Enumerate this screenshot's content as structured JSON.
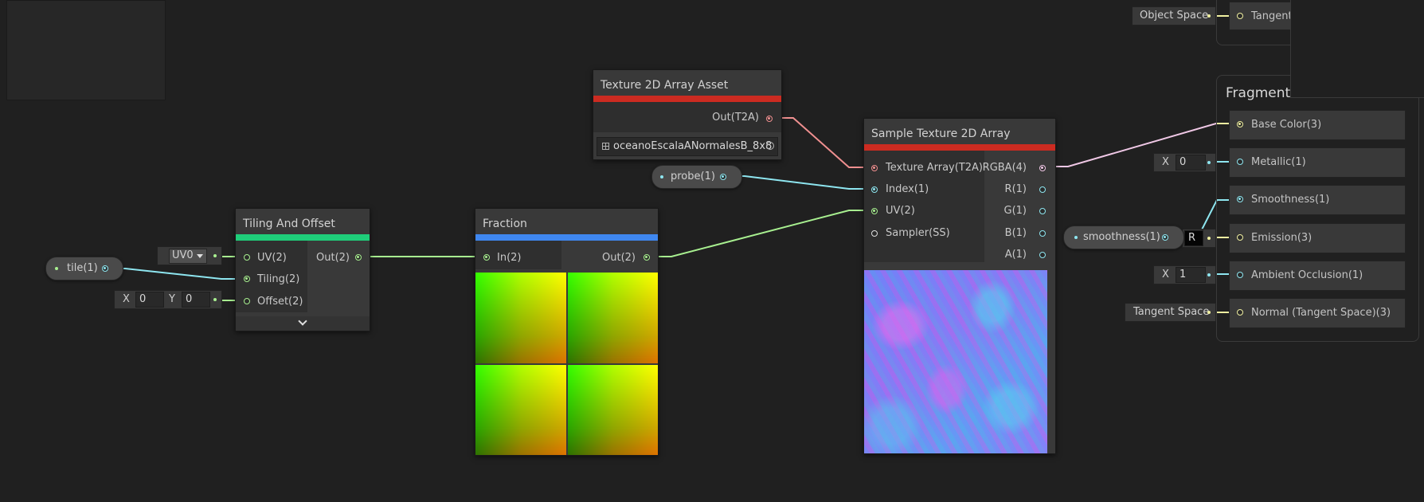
{
  "colors": {
    "background": "#202020",
    "node_body": "#393939",
    "tiling_bar": "#1fce7a",
    "fraction_bar": "#3f87f0",
    "texture_bar": "#cc2b21",
    "wire_red": "#f09090",
    "wire_cyan": "#8ee6f0",
    "wire_green": "#a8f090",
    "wire_yellow": "#f0f0a0",
    "wire_pink": "#f0c8e6"
  },
  "nodes": {
    "texture_asset": {
      "title": "Texture 2D Array Asset",
      "out_label": "Out(T2A)",
      "asset_name": "oceanoEscalaANormalesB_8x8",
      "grid_icon": "grid-icon",
      "picker_icon": "target-icon"
    },
    "sample_texture": {
      "title": "Sample Texture 2D Array",
      "inputs": [
        "Texture Array(T2A)",
        "Index(1)",
        "UV(2)",
        "Sampler(SS)"
      ],
      "outputs": [
        "RGBA(4)",
        "R(1)",
        "G(1)",
        "B(1)",
        "A(1)"
      ]
    },
    "tiling": {
      "title": "Tiling And Offset",
      "inputs": [
        "UV(2)",
        "Tiling(2)",
        "Offset(2)"
      ],
      "output": "Out(2)",
      "expand_icon": "chevron-down-icon"
    },
    "fraction": {
      "title": "Fraction",
      "input": "In(2)",
      "output": "Out(2)"
    },
    "fragment": {
      "title": "Fragment",
      "slots": [
        "Base Color(3)",
        "Metallic(1)",
        "Smoothness(1)",
        "Emission(3)",
        "Ambient Occlusion(1)",
        "Normal (Tangent Space)(3)"
      ]
    },
    "vertex": {
      "partial_slot": "Tangent"
    }
  },
  "properties": {
    "probe": "probe(1)",
    "tile": "tile(1)",
    "smoothness": "smoothness(1)"
  },
  "inline_inputs": {
    "uv_dropdown": "UV0",
    "offset_x_label": "X",
    "offset_x": "0",
    "offset_y_label": "Y",
    "offset_y": "0",
    "metallic_label": "X",
    "metallic_value": "0",
    "ao_label": "X",
    "ao_value": "1",
    "emission_partial": "R",
    "object_space": "Object Space",
    "tangent_space": "Tangent Space"
  }
}
